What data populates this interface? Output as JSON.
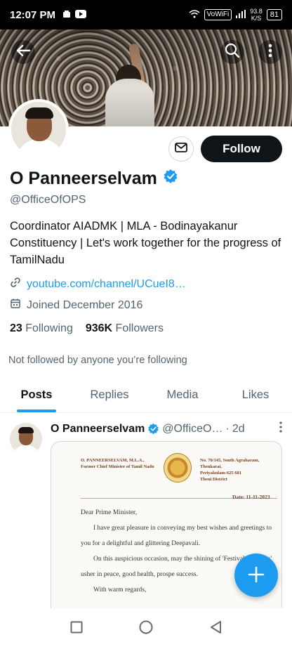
{
  "status_bar": {
    "time": "12:07 PM",
    "wifi_label": "VoWiFi",
    "net_speed_value": "93.8",
    "net_speed_unit": "K/S",
    "battery": "81"
  },
  "profile": {
    "name": "O Panneerselvam",
    "handle": "@OfficeOfOPS",
    "bio": "Coordinator AIADMK | MLA - Bodinayakanur Constituency | Let's work together for the progress of TamilNadu",
    "link": "youtube.com/channel/UCueI8…",
    "joined": "Joined December 2016",
    "following_count": "23",
    "following_label": "Following",
    "followers_count": "936K",
    "followers_label": "Followers",
    "not_followed": "Not followed by anyone you’re following",
    "follow_button": "Follow"
  },
  "tabs": [
    {
      "label": "Posts",
      "active": true
    },
    {
      "label": "Replies",
      "active": false
    },
    {
      "label": "Media",
      "active": false
    },
    {
      "label": "Likes",
      "active": false
    }
  ],
  "tweet": {
    "name": "O Panneerselvam",
    "handle": "@OfficeO…",
    "dot": "·",
    "time": "2d",
    "letter": {
      "left_line1": "O. PANNEERSELVAM, M.L.A.,",
      "left_line2": "Former Chief Minister of Tamil Nadu",
      "right_line1": "No. 70/145, South Agraharam,",
      "right_line2": "Thenkarai,",
      "right_line3": "Periyakulam-625 601",
      "right_line4": "Theni District",
      "date": "Date: 11-11-2023",
      "salutation": "Dear Prime Minister,",
      "para1": "I have great pleasure in conveying my best wishes and greetings to you for a delightful and glittering Deepavali.",
      "para2": "On this auspicious occasion, may the shining of 'Festival of Lights' usher in peace, good health, prospe success.",
      "closing": "With warm regards,"
    }
  },
  "colors": {
    "accent": "#1d9bf0",
    "text": "#0f1419",
    "muted": "#536471"
  }
}
